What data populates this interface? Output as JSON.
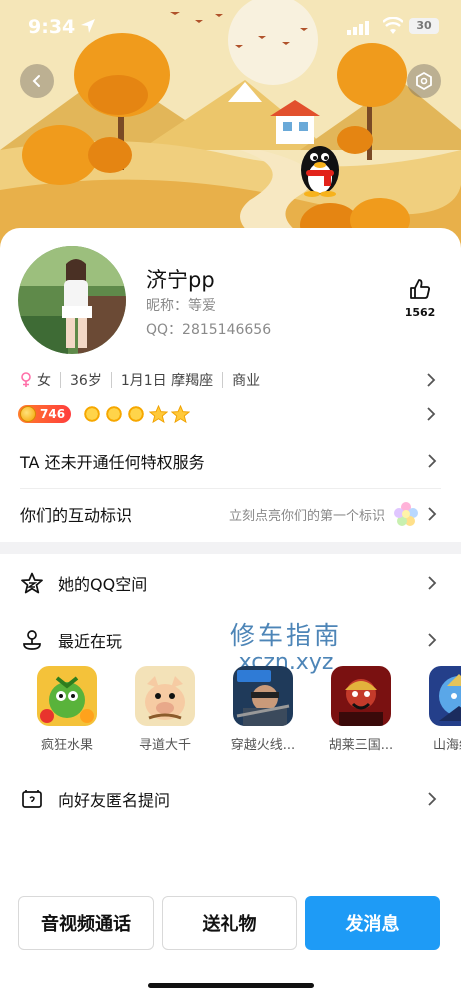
{
  "status_bar": {
    "time": "9:34",
    "battery": "30"
  },
  "profile": {
    "name": "济宁pp",
    "nickname": "昵称：等爱",
    "qq": "QQ：2815146656",
    "likes": "1562"
  },
  "info": {
    "gender": "女",
    "age": "36岁",
    "birthday": "1月1日 摩羯座",
    "industry": "商业"
  },
  "level": {
    "value": "746"
  },
  "rows": {
    "privilege": "TA 还未开通任何特权服务",
    "interaction": "你们的互动标识",
    "interaction_hint": "立刻点亮你们的第一个标识",
    "qzone": "她的QQ空间",
    "recent": "最近在玩",
    "ask": "向好友匿名提问"
  },
  "games": [
    {
      "label": "疯狂水果"
    },
    {
      "label": "寻道大千"
    },
    {
      "label": "穿越火线..."
    },
    {
      "label": "胡莱三国..."
    },
    {
      "label": "山海经异"
    }
  ],
  "watermark": {
    "cn": "修车指南",
    "en": "xczn.xyz"
  },
  "buttons": {
    "call": "音视频通话",
    "gift": "送礼物",
    "message": "发消息"
  },
  "colors": {
    "accent": "#1e9bf6",
    "gender": "#ff6fa8",
    "level_badge": "#ff5a30"
  }
}
